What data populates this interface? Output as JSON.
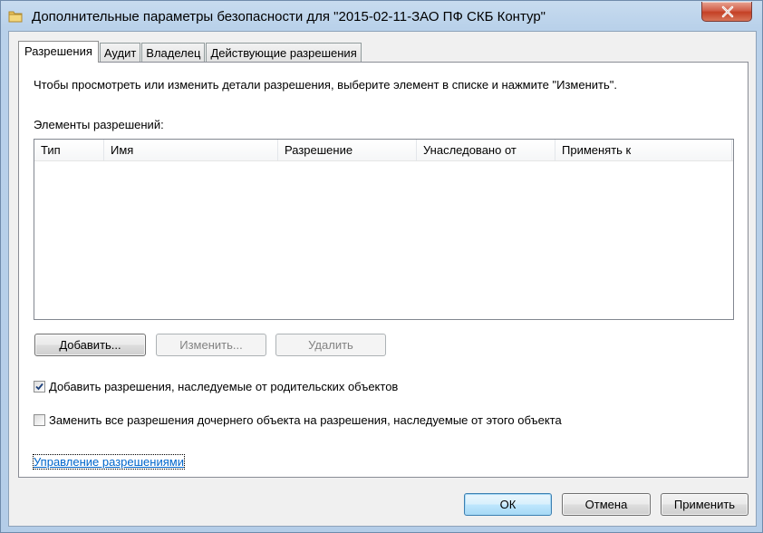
{
  "window": {
    "title": "Дополнительные параметры безопасности  для \"2015-02-11-ЗАО ПФ СКБ Контур\""
  },
  "tabs": [
    {
      "label": "Разрешения"
    },
    {
      "label": "Аудит"
    },
    {
      "label": "Владелец"
    },
    {
      "label": "Действующие разрешения"
    }
  ],
  "permissions": {
    "instructions": "Чтобы просмотреть или изменить детали разрешения, выберите элемент в списке и нажмите \"Изменить\".",
    "list_label": "Элементы разрешений:",
    "columns": [
      "Тип",
      "Имя",
      "Разрешение",
      "Унаследовано от",
      "Применять к"
    ],
    "rows": [],
    "buttons": {
      "add": "Добавить...",
      "edit": "Изменить...",
      "remove": "Удалить"
    },
    "checkbox_inherit": {
      "label": "Добавить разрешения, наследуемые от родительских объектов",
      "checked": true
    },
    "checkbox_replace": {
      "label": "Заменить все разрешения дочернего объекта на разрешения, наследуемые от этого объекта",
      "checked": false
    },
    "manage_link": "Управление разрешениями"
  },
  "footer": {
    "ok": "ОК",
    "cancel": "Отмена",
    "apply": "Применить"
  },
  "icons": {
    "title": "folder-icon",
    "close": "close-icon",
    "check": "checkmark-icon"
  }
}
